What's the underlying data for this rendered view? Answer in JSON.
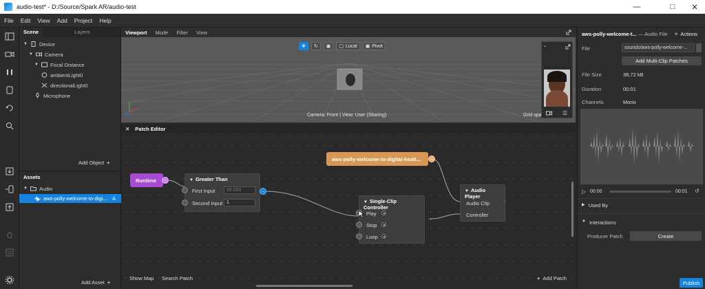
{
  "window": {
    "title": "audio-test* - D:/Source/Spark AR/audio-test"
  },
  "menu": [
    "File",
    "Edit",
    "View",
    "Add",
    "Project",
    "Help"
  ],
  "scene": {
    "tabs": [
      "Scene",
      "Layers"
    ],
    "tree": [
      "Device",
      "Camera",
      "Focal Distance",
      "ambientLight0",
      "directionalLight0",
      "Microphone"
    ],
    "add_object": "Add Object",
    "add_object_plus": "+"
  },
  "assets": {
    "title": "Assets",
    "folder": "Audio",
    "selected_item": "aws-polly-welcome-to-digi...",
    "selected_badge": "A",
    "add_asset": "Add Asset",
    "add_asset_plus": "+"
  },
  "viewport": {
    "tabs": [
      "Viewport",
      "Mode",
      "Filter",
      "View"
    ],
    "local_label": "Local",
    "pivot_label": "Pivot",
    "status": "Camera: Front | View: User (Sharing)",
    "grid": "Grid spa"
  },
  "patch_editor": {
    "title": "Patch Editor",
    "runtime": "Runtime",
    "greater_than": {
      "title": "Greater Than",
      "first_input_label": "First Input",
      "first_input_value": "89.093",
      "second_input_label": "Second Input",
      "second_input_value": "1"
    },
    "audio_file_node": "aws-polly-welcome-to-digital-healt...",
    "audio_player": {
      "title": "Audio Player",
      "ports": [
        "Audio Clip",
        "Controller"
      ]
    },
    "single_clip": {
      "title": "Single-Clip Controller",
      "ports": [
        "Play",
        "Stop",
        "Loop"
      ]
    },
    "show_map": "Show Map",
    "search_patch": "Search Patch",
    "add_patch": "Add Patch"
  },
  "inspector": {
    "title": "aws-polly-welcome-t...",
    "subtitle": "— Audio File",
    "actions": "Actions",
    "file_label": "File",
    "file_value": "sounds/aws-polly-welcome-...",
    "add_multi_clip": "Add Multi-Clip Patches",
    "file_size_label": "File Size",
    "file_size_value": "38,72 kB",
    "duration_label": "Duration",
    "duration_value": "00:01",
    "channels_label": "Channels",
    "channels_value": "Mono",
    "time_start": "00:00",
    "time_end": "00:01",
    "used_by": "Used By",
    "interactions": "Interactions",
    "producer_patch": "Producer Patch",
    "create": "Create",
    "publish": "Publish"
  }
}
